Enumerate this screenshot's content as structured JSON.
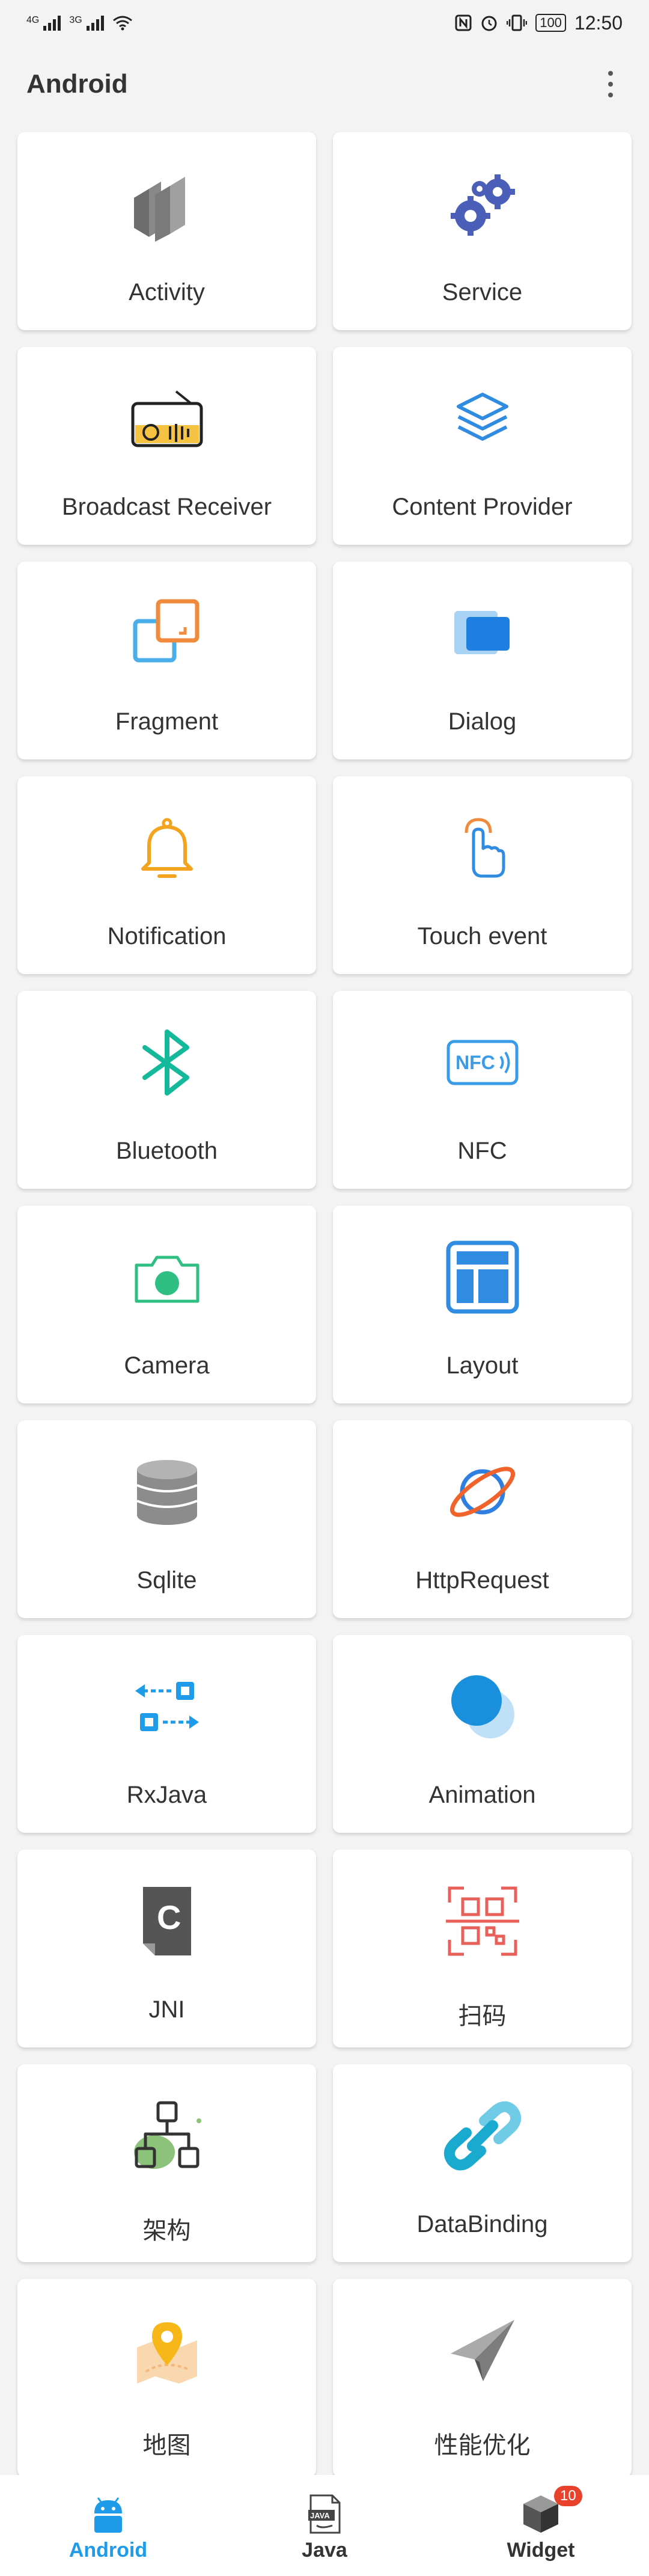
{
  "status": {
    "net1": "4G",
    "net2": "3G",
    "battery": "100",
    "time": "12:50"
  },
  "appbar": {
    "title": "Android"
  },
  "cards": [
    {
      "label": "Activity",
      "icon": "activity-icon"
    },
    {
      "label": "Service",
      "icon": "gears-icon"
    },
    {
      "label": "Broadcast Receiver",
      "icon": "radio-icon"
    },
    {
      "label": "Content Provider",
      "icon": "layers-icon"
    },
    {
      "label": "Fragment",
      "icon": "fragment-icon"
    },
    {
      "label": "Dialog",
      "icon": "dialog-icon"
    },
    {
      "label": "Notification",
      "icon": "bell-icon"
    },
    {
      "label": "Touch event",
      "icon": "hand-pointer-icon"
    },
    {
      "label": "Bluetooth",
      "icon": "bluetooth-icon"
    },
    {
      "label": "NFC",
      "icon": "nfc-icon"
    },
    {
      "label": "Camera",
      "icon": "camera-icon"
    },
    {
      "label": "Layout",
      "icon": "layout-icon"
    },
    {
      "label": "Sqlite",
      "icon": "database-icon"
    },
    {
      "label": "HttpRequest",
      "icon": "planet-icon"
    },
    {
      "label": "RxJava",
      "icon": "transfer-arrows-icon"
    },
    {
      "label": "Animation",
      "icon": "circles-icon"
    },
    {
      "label": "JNI",
      "icon": "c-file-icon"
    },
    {
      "label": "扫码",
      "icon": "qr-scan-icon"
    },
    {
      "label": "架构",
      "icon": "architecture-icon"
    },
    {
      "label": "DataBinding",
      "icon": "link-icon"
    },
    {
      "label": "地图",
      "icon": "map-pin-icon"
    },
    {
      "label": "性能优化",
      "icon": "paper-plane-icon"
    }
  ],
  "tabs": [
    {
      "label": "Android",
      "icon": "android-icon",
      "active": true
    },
    {
      "label": "Java",
      "icon": "java-file-icon",
      "active": false
    },
    {
      "label": "Widget",
      "icon": "cube-icon",
      "active": false,
      "badge": "10"
    }
  ],
  "colors": {
    "accent": "#1e9be9",
    "badge": "#e8412c",
    "background": "#f3f3f3"
  }
}
